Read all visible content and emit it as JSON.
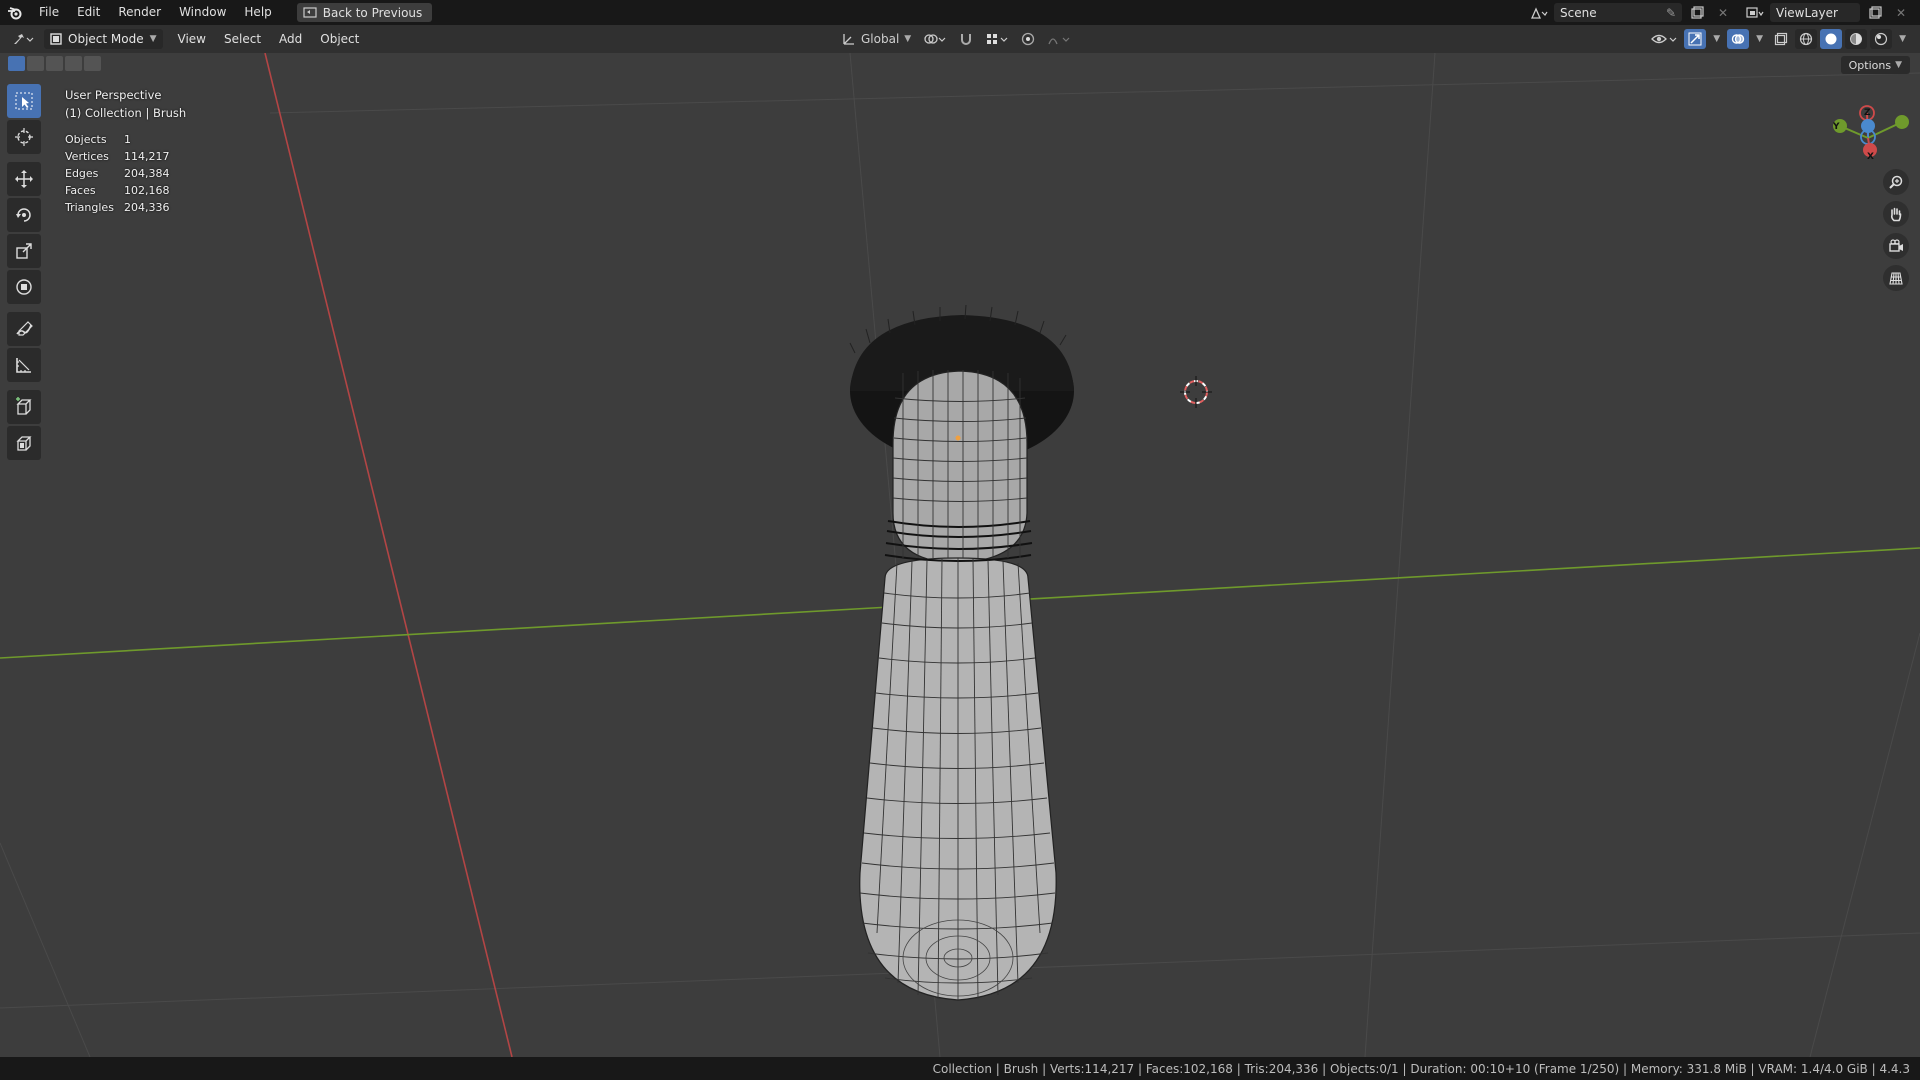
{
  "menubar": {
    "items": [
      "File",
      "Edit",
      "Render",
      "Window",
      "Help"
    ],
    "back_button": "Back to Previous",
    "scene": "Scene",
    "view_layer": "ViewLayer"
  },
  "viewport_header": {
    "mode": "Object Mode",
    "menus": [
      "View",
      "Select",
      "Add",
      "Object"
    ],
    "transform_orientation": "Global"
  },
  "viewport": {
    "perspective": "User Perspective",
    "collection": "(1) Collection | Brush",
    "options_label": "Options",
    "stats": [
      {
        "label": "Objects",
        "value": "1"
      },
      {
        "label": "Vertices",
        "value": "114,217"
      },
      {
        "label": "Edges",
        "value": "204,384"
      },
      {
        "label": "Faces",
        "value": "102,168"
      },
      {
        "label": "Triangles",
        "value": "204,336"
      }
    ],
    "gizmo": {
      "x": "X",
      "y": "Y",
      "z": "Z"
    }
  },
  "statusbar": {
    "text": "Collection | Brush | Verts:114,217 | Faces:102,168 | Tris:204,336 | Objects:0/1 | Duration: 00:10+10 (Frame 1/250) | Memory: 331.8 MiB | VRAM: 1.4/4.0 GiB | 4.4.3"
  },
  "colors": {
    "accent": "#4772b3",
    "viewport_bg": "#3d3d3d",
    "x_axis": "#b34545",
    "y_axis": "#6f9a2c"
  }
}
